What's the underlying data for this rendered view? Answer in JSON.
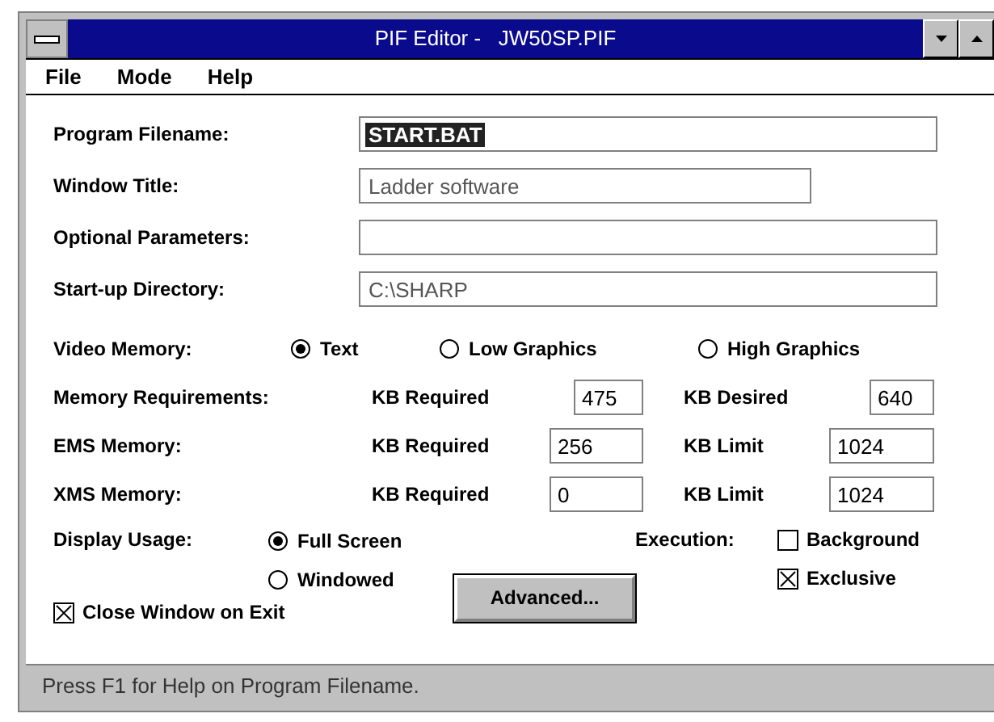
{
  "window": {
    "title": "PIF Editor -   JW50SP.PIF"
  },
  "menu": [
    "File",
    "Mode",
    "Help"
  ],
  "fields": [
    {
      "label": "Program Filename:",
      "value": "START.BAT",
      "highlighted": true
    },
    {
      "label": "Window Title:",
      "value": "Ladder software",
      "highlighted": false
    },
    {
      "label": "Optional Parameters:"
    },
    {
      "label": "Start-up Directory:",
      "value": "C:\\SHARP",
      "highlighted": false
    }
  ],
  "video_memory": {
    "label": "Video Memory:",
    "options": [
      {
        "label": "Text",
        "selected": true
      },
      {
        "label": "Low Graphics",
        "selected": false
      },
      {
        "label": "High Graphics",
        "selected": false
      }
    ]
  },
  "memory_rows": [
    {
      "label": "Memory Requirements:",
      "fields": [
        {
          "label": "KB Required",
          "value": "475"
        },
        {
          "label": "KB Desired",
          "value": "640"
        }
      ]
    },
    {
      "label": "EMS Memory:",
      "fields": [
        {
          "label": "KB Required",
          "value": "256"
        },
        {
          "label": "KB Limit",
          "value": "1024"
        }
      ]
    },
    {
      "label": "XMS Memory:",
      "fields": [
        {
          "label": "KB Required",
          "value": "0"
        },
        {
          "label": "KB Limit",
          "value": "1024"
        }
      ]
    }
  ],
  "display_usage": {
    "label": "Display Usage:",
    "options": [
      {
        "label": "Full Screen",
        "selected": true
      },
      {
        "label": "Windowed",
        "selected": false
      }
    ]
  },
  "execution": {
    "label": "Execution:",
    "options": [
      {
        "label": "Background",
        "checked": false
      },
      {
        "label": "Exclusive",
        "checked": true
      }
    ]
  },
  "close_on_exit": {
    "label": "Close Window on Exit",
    "checked": true
  },
  "advanced_button": "Advanced...",
  "status_bar": "Press F1 for Help on Program Filename."
}
